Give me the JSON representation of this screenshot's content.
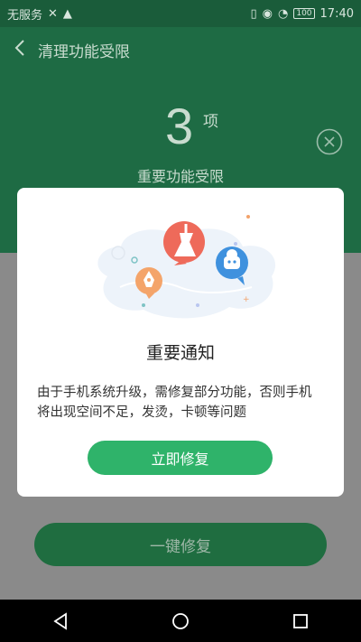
{
  "status_bar": {
    "carrier": "无服务",
    "battery": "100",
    "time": "17:40"
  },
  "header": {
    "title": "清理功能受限",
    "count": "3",
    "unit": "项",
    "subtitle": "重要功能受限"
  },
  "content": {
    "fix_all_label": "一键修复"
  },
  "dialog": {
    "title": "重要通知",
    "body": "由于手机系统升级，需修复部分功能，否则手机将出现空间不足，发烫，卡顿等问题",
    "button_label": "立即修复"
  },
  "colors": {
    "brand_green": "#2fb36a",
    "header_dim": "#1e6b44"
  },
  "icons": [
    "back-icon",
    "close-icon",
    "broom-icon",
    "rocket-icon",
    "robot-icon",
    "back-nav-icon",
    "home-nav-icon",
    "recents-nav-icon"
  ]
}
